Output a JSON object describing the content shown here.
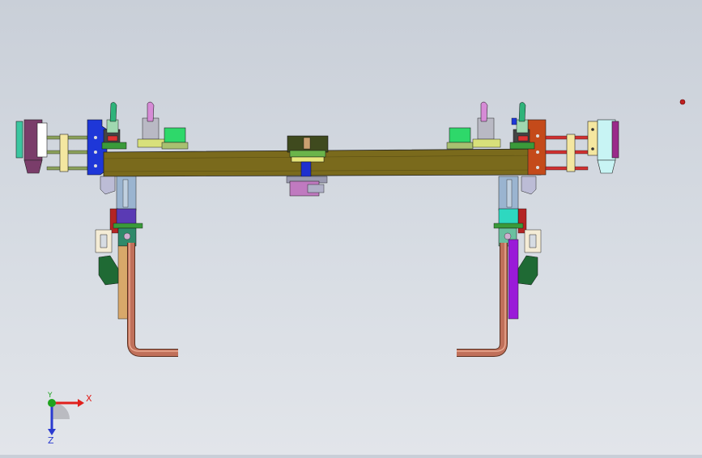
{
  "triad": {
    "x_label": "X",
    "y_label": "Y",
    "z_label": "Z",
    "x_color": "#e0201c",
    "y_color": "#1ea31e",
    "z_color": "#2a3ad0"
  },
  "model": {
    "beam_color": "#7a6a1c",
    "pipe_color": "#c0705a"
  }
}
